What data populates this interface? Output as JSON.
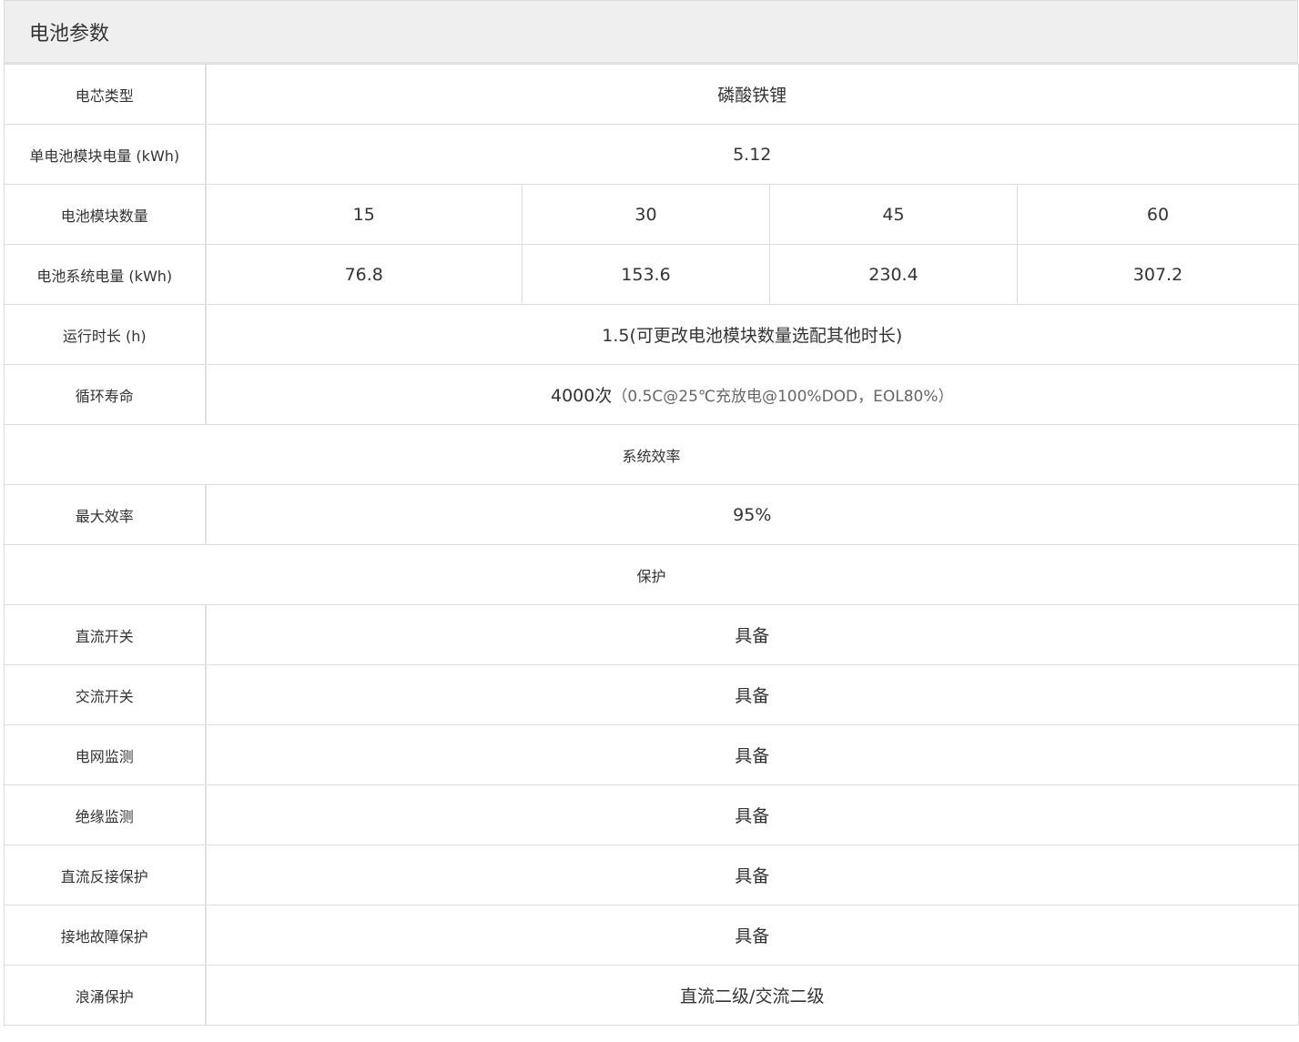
{
  "title": "电池参数",
  "columns": [
    "",
    "",
    "",
    "",
    ""
  ],
  "rows": {
    "cell_type": {
      "label": "电芯类型",
      "value": "磷酸铁锂"
    },
    "module_energy": {
      "label": "单电池模块电量 (kWh)",
      "value": "5.12"
    },
    "module_count": {
      "label": "电池模块数量",
      "values": [
        "15",
        "30",
        "45",
        "60"
      ]
    },
    "system_energy": {
      "label": "电池系统电量 (kWh)",
      "values": [
        "76.8",
        "153.6",
        "230.4",
        "307.2"
      ]
    },
    "runtime": {
      "label": "运行时长 (h)",
      "value": "1.5(可更改电池模块数量选配其他时长)"
    },
    "cycle_life": {
      "label": "循环寿命",
      "value_main": "4000次",
      "value_note": "（0.5C@25℃充放电@100%DOD，EOL80%）"
    },
    "efficiency_section": "系统效率",
    "max_efficiency": {
      "label": "最大效率",
      "value": "95%"
    },
    "protection_section": "保护",
    "dc_switch": {
      "label": "直流开关",
      "value": "具备"
    },
    "ac_switch": {
      "label": "交流开关",
      "value": "具备"
    },
    "grid_monitor": {
      "label": "电网监测",
      "value": "具备"
    },
    "insulation_monitor": {
      "label": "绝缘监测",
      "value": "具备"
    },
    "dc_reverse_protection": {
      "label": "直流反接保护",
      "value": "具备"
    },
    "ground_fault_protection": {
      "label": "接地故障保护",
      "value": "具备"
    },
    "surge_protection": {
      "label": "浪涌保护",
      "value": "直流二级/交流二级"
    }
  }
}
